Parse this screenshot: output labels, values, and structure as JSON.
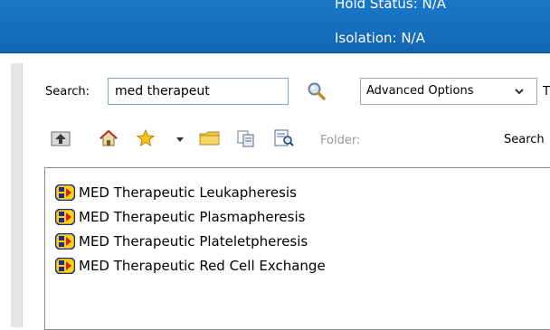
{
  "header": {
    "hold_status": "Hold Status: N/A",
    "isolation": "Isolation: N/A"
  },
  "search": {
    "label": "Search:",
    "value": "med therapeut",
    "advanced_options": "Advanced Options",
    "cut_label": "T"
  },
  "toolbar": {
    "icons": [
      "up-folder-icon",
      "home-icon",
      "favorites-star-icon",
      "dropdown-arrow-icon",
      "folder-icon",
      "copy-icon",
      "search-results-icon"
    ],
    "folder_label": "Folder:",
    "search_label": "Search"
  },
  "results": [
    {
      "label": "MED Therapeutic Leukapheresis",
      "icon": "orderable-item-icon"
    },
    {
      "label": "MED Therapeutic Plasmapheresis",
      "icon": "orderable-item-icon"
    },
    {
      "label": "MED Therapeutic Plateletpheresis",
      "icon": "orderable-item-icon"
    },
    {
      "label": "MED Therapeutic Red Cell Exchange",
      "icon": "orderable-item-icon"
    }
  ],
  "colors": {
    "header_blue": "#1a78c8",
    "input_border": "#7aa7d8",
    "item_icon_yellow": "#ffd400",
    "item_icon_blue": "#1e2a9a",
    "item_icon_red": "#d22020"
  }
}
